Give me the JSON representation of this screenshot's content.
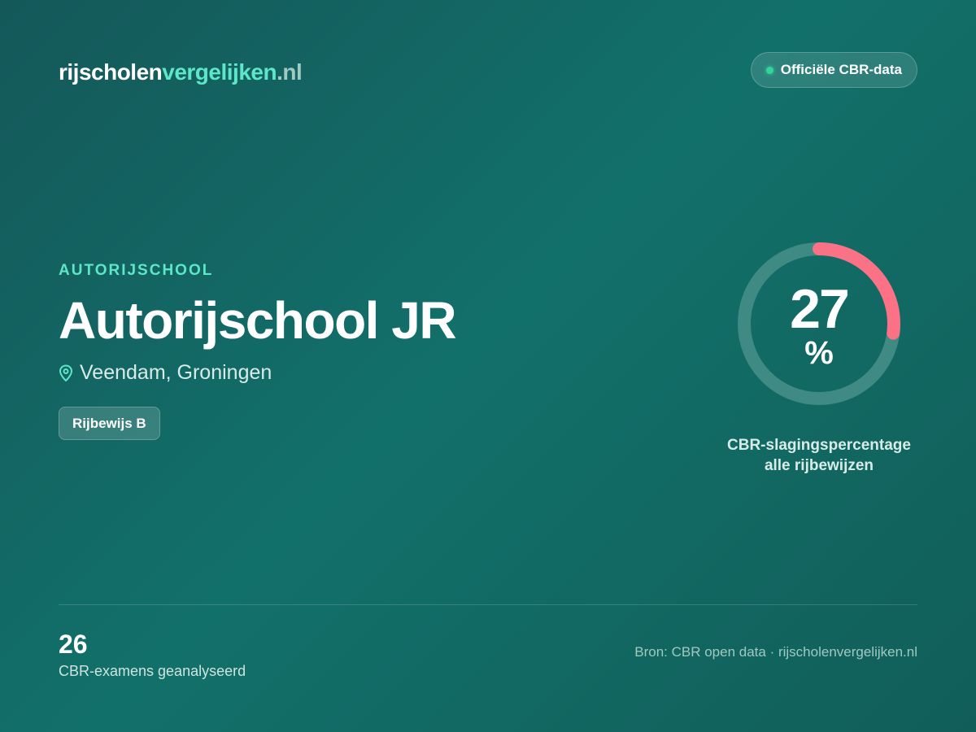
{
  "logo": {
    "part1": "rijscholen",
    "part2": "vergelijken",
    "part3": ".nl"
  },
  "badge": {
    "label": "Officiële CBR-data"
  },
  "school": {
    "kicker": "AUTORIJSCHOOL",
    "name": "Autorijschool JR",
    "location": "Veendam, Groningen",
    "license_chip": "Rijbewijs B"
  },
  "gauge": {
    "value": 27,
    "value_text": "27",
    "unit": "%",
    "caption_line1": "CBR-slagingspercentage",
    "caption_line2": "alle rijbewijzen",
    "track_color": "#3f8a82",
    "arc_color": "#fb7185"
  },
  "stats": {
    "count": "26",
    "count_label": "CBR-examens geanalyseerd"
  },
  "footer": {
    "source": "Bron: CBR open data · rijscholenvergelijken.nl"
  },
  "colors": {
    "accent": "#5ee6c8",
    "status_dot": "#34d399"
  }
}
